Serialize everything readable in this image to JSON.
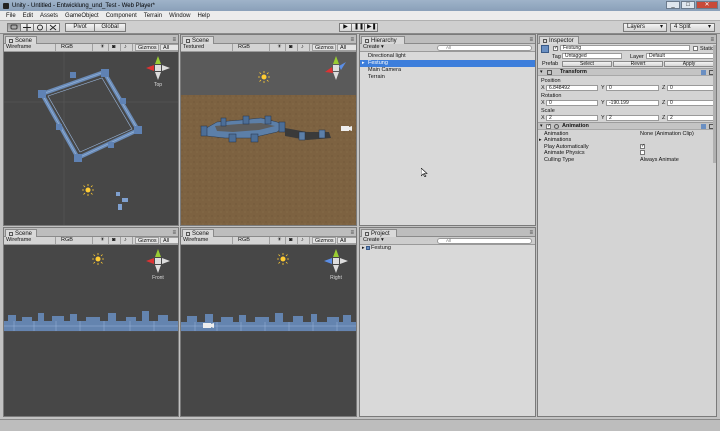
{
  "window": {
    "title": "Unity - Untitled - Entwicklung_und_Test - Web Player*",
    "min": "_",
    "max": "□",
    "close": "✕"
  },
  "menu": [
    "File",
    "Edit",
    "Assets",
    "GameObject",
    "Component",
    "Terrain",
    "Window",
    "Help"
  ],
  "toolbar": {
    "pivot_label": "Pivot",
    "global_label": "Global",
    "play_icon": "▶",
    "pause_icon": "❚❚",
    "step_icon": "▶❚",
    "layers_label": "Layers",
    "layout_label": "4 Split",
    "caret": "▾"
  },
  "scene_views": [
    {
      "tab": "Scene",
      "mode": "Wireframe",
      "color": "RGB",
      "gizmos": "Gizmos ▾",
      "search": "All",
      "label": "Top"
    },
    {
      "tab": "Scene",
      "mode": "Textured",
      "color": "RGB",
      "gizmos": "Gizmos ▾",
      "search": "All",
      "label": ""
    },
    {
      "tab": "Scene",
      "mode": "Wireframe",
      "color": "RGB",
      "gizmos": "Gizmos ▾",
      "search": "All",
      "label": "Front"
    },
    {
      "tab": "Scene",
      "mode": "Wireframe",
      "color": "RGB",
      "gizmos": "Gizmos ▾",
      "search": "All",
      "label": "Right"
    }
  ],
  "hierarchy": {
    "tab": "Hierarchy",
    "create": "Create ▾",
    "search": "All",
    "items": [
      "Directional light",
      "Festung",
      "Main Camera",
      "Terrain"
    ],
    "selected_index": 1
  },
  "project": {
    "tab": "Project",
    "create": "Create ▾",
    "search": "All",
    "items": [
      "Festung"
    ]
  },
  "inspector": {
    "tab": "Inspector",
    "object_name": "Festung",
    "static_label": "Static",
    "tag_label": "Tag",
    "tag_value": "Untagged",
    "layer_label": "Layer",
    "layer_value": "Default",
    "prefab_label": "Prefab",
    "select_label": "Select",
    "revert_label": "Revert",
    "apply_label": "Apply",
    "transform": {
      "title": "Transform",
      "position_label": "Position",
      "position": [
        "6.848492",
        "0",
        "0"
      ],
      "rotation_label": "Rotation",
      "rotation": [
        "0",
        "-190.199",
        "0"
      ],
      "scale_label": "Scale",
      "scale": [
        "2",
        "2",
        "2"
      ],
      "axes": [
        "X",
        "Y",
        "Z"
      ]
    },
    "animation": {
      "title": "Animation",
      "animation_label": "Animation",
      "animation_value": "None (Animation Clip)",
      "animations_label": "Animations",
      "play_auto_label": "Play Automatically",
      "play_auto": true,
      "physics_label": "Animate Physics",
      "physics": false,
      "culling_label": "Culling Type",
      "culling_value": "Always Animate"
    }
  }
}
